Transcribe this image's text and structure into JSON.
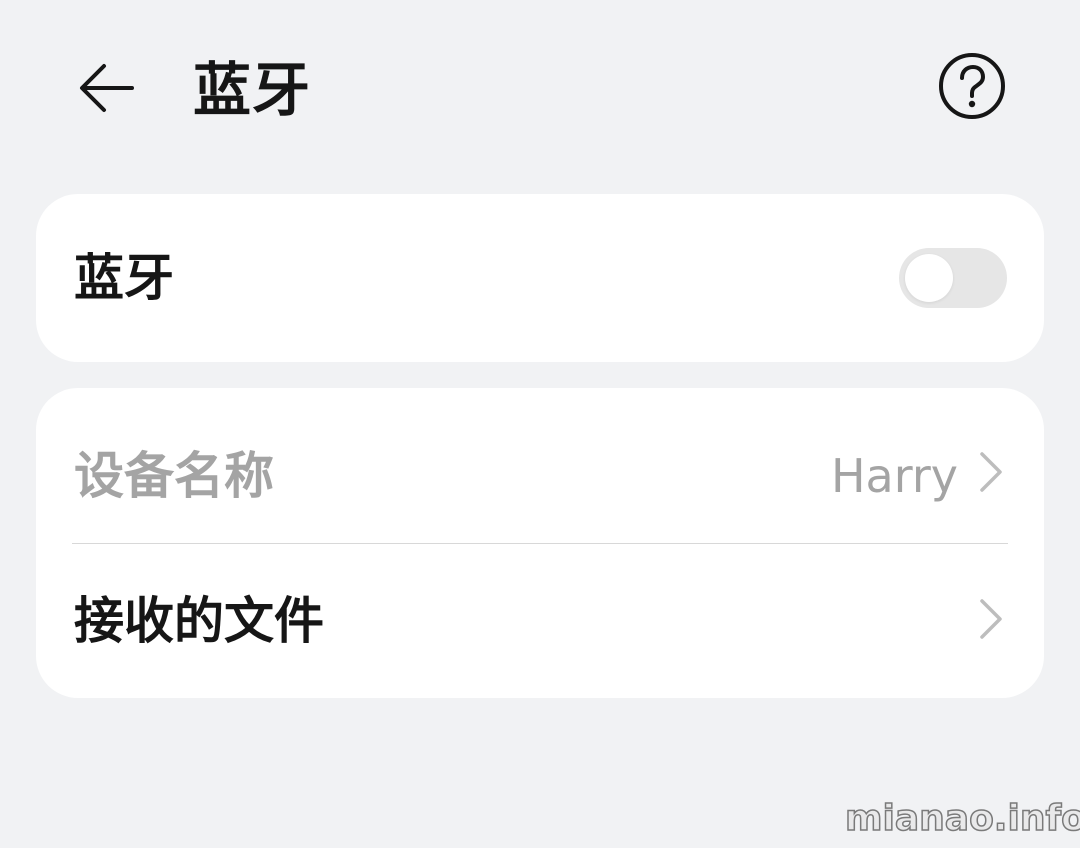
{
  "header": {
    "title": "蓝牙",
    "back_icon": "back-arrow-icon",
    "help_icon": "help-icon"
  },
  "bluetooth": {
    "label": "蓝牙",
    "enabled": false
  },
  "settings": {
    "device_name": {
      "label": "设备名称",
      "value": "Harry",
      "icon": "chevron-right-icon"
    },
    "received_files": {
      "label": "接收的文件",
      "icon": "chevron-right-icon"
    }
  },
  "watermark": "mianao.info",
  "colors": {
    "background": "#f1f2f4",
    "card": "#ffffff",
    "text_primary": "#161616",
    "text_disabled": "#a4a4a4",
    "toggle_off": "#e6e6e6"
  }
}
